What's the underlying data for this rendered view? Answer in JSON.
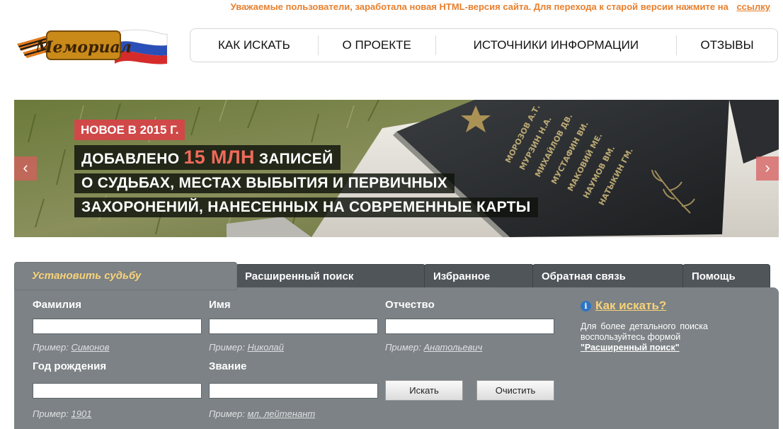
{
  "notice": {
    "text": "Уважаемые пользователи, заработала новая HTML-версия сайта. Для перехода к старой версии нажмите на",
    "link": "ссылку"
  },
  "logo": {
    "text": "Мемориал"
  },
  "nav": {
    "items": [
      "КАК ИСКАТЬ",
      "О ПРОЕКТЕ",
      "ИСТОЧНИКИ ИНФОРМАЦИИ",
      "ОТЗЫВЫ"
    ]
  },
  "banner": {
    "tag": "НОВОЕ В 2015 Г.",
    "line1_pre": "ДОБАВЛЕНО",
    "line1_big": "15 МЛН",
    "line1_post": "ЗАПИСЕЙ",
    "line2": "О СУДЬБАХ, МЕСТАХ ВЫБЫТИЯ И ПЕРВИЧНЫХ",
    "line3": "ЗАХОРОНЕНИЙ, НАНЕСЕННЫХ НА СОВРЕМЕННЫЕ КАРТЫ",
    "prev": "‹",
    "next": "›",
    "stone_names": [
      "МОРОЗОВ А.Т.",
      "МУРЗИН Н.А.",
      "МИХАЙЛОВ ДВ.",
      "МУСТАФИН ВИ.",
      "МАКОВИЙ МЕ.",
      "НАУМОВ ВМ.",
      "НАТЫКИН ГМ."
    ]
  },
  "tabs": [
    "Установить судьбу",
    "Расширенный поиск",
    "Избранное",
    "Обратная связь",
    "Помощь"
  ],
  "form": {
    "surname": {
      "label": "Фамилия",
      "value": "",
      "example_prefix": "Пример:",
      "example": "Симонов"
    },
    "name": {
      "label": "Имя",
      "value": "",
      "example_prefix": "Пример:",
      "example": "Николай"
    },
    "patronymic": {
      "label": "Отчество",
      "value": "",
      "example_prefix": "Пример:",
      "example": "Анатольевич"
    },
    "birth_year": {
      "label": "Год рождения",
      "value": "",
      "example_prefix": "Пример:",
      "example": "1901"
    },
    "rank": {
      "label": "Звание",
      "value": "",
      "example_prefix": "Пример:",
      "example": "мл. лейтенант"
    },
    "search_button": "Искать",
    "clear_button": "Очистить"
  },
  "help": {
    "icon": "i",
    "title": "Как искать?",
    "text": "Для более детального поиска воспользуйтесь формой",
    "link": "\"Расширенный поиск\""
  },
  "colors": {
    "accent_orange": "#e8802e",
    "panel_gray": "#7c8285",
    "tab_dark": "#50555a",
    "tab_active_text": "#f7d27a",
    "banner_red": "#d04848",
    "highlight_red": "#f06a5a"
  }
}
